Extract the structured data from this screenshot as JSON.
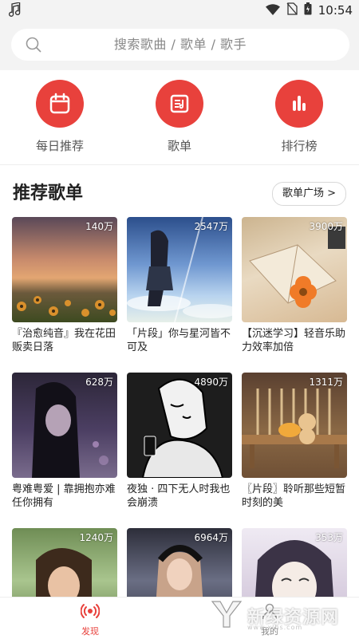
{
  "status_bar": {
    "time": "10:54"
  },
  "search": {
    "placeholder": "搜索歌曲 / 歌单 / 歌手"
  },
  "categories": [
    {
      "label": "每日推荐",
      "icon": "calendar-icon"
    },
    {
      "label": "歌单",
      "icon": "playlist-icon"
    },
    {
      "label": "排行榜",
      "icon": "chart-bars-icon"
    }
  ],
  "section": {
    "title": "推荐歌单",
    "more_label": "歌单广场 >"
  },
  "playlists": [
    {
      "count": "140万",
      "title": "『治愈纯音』我在花田贩卖日落"
    },
    {
      "count": "2547万",
      "title": "「片段」你与星河皆不可及"
    },
    {
      "count": "3900万",
      "title": "【沉迷学习】轻音乐助力效率加倍"
    },
    {
      "count": "628万",
      "title": "粤难粤爱 | 靠拥抱亦难任你拥有"
    },
    {
      "count": "4890万",
      "title": "夜独 · 四下无人时我也会崩溃"
    },
    {
      "count": "1311万",
      "title": "〖片段〗聆听那些短暂时刻的美"
    },
    {
      "count": "1240万",
      "title": ""
    },
    {
      "count": "6964万",
      "title": ""
    },
    {
      "count": "353万",
      "title": ""
    }
  ],
  "bottom_nav": {
    "discover_label": "发现",
    "mine_label": "我的"
  },
  "watermark": {
    "text": "新绿资源网",
    "sub": "www.xlhs.com"
  },
  "colors": {
    "accent": "#e8413c"
  }
}
